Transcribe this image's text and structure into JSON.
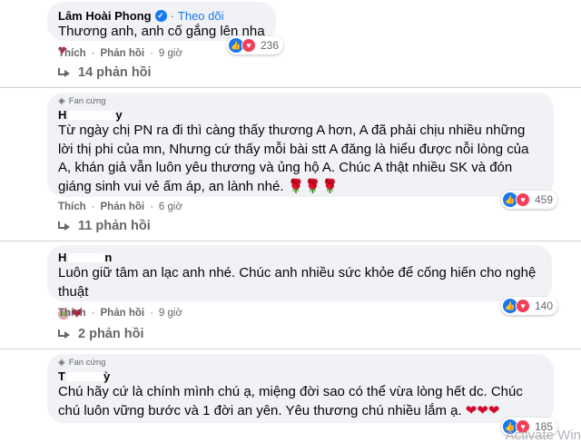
{
  "comments": [
    {
      "author": "Lâm Hoài Phong",
      "follow_label": "Theo dõi",
      "text": "Thương anh, anh cố gắng lên nha",
      "text_emoji": "♥",
      "reaction_count": "236",
      "like_label": "Thích",
      "reply_label": "Phản hồi",
      "time": "9 giờ",
      "replies_label": "14 phản hồi"
    },
    {
      "badge": "Fan cứng",
      "name_visible": "H",
      "name_tail": "y",
      "text": "Từ ngày chị PN ra đi thì càng thấy thương A hơn, A đã phải chịu nhiều những lời thị phi của mn, Nhưng cứ thấy mỗi bài stt A đăng là hiểu được nỗi lòng của A, khán giả vẫn luôn yêu thương và ủng hộ A. Chúc A thật nhiều SK và đón giáng sinh vui vẻ ấm áp, an lành nhé.",
      "text_emoji": "🌹🌹🌹",
      "reaction_count": "459",
      "like_label": "Thích",
      "reply_label": "Phản hồi",
      "time": "6 giờ",
      "replies_label": "11 phản hồi"
    },
    {
      "name_visible": "H",
      "name_tail": "n",
      "text": "Luôn giữ tâm an lạc anh nhé. Chúc anh nhiều sức khỏe để cống hiến cho nghệ thuật",
      "sticker": "❤",
      "reaction_count": "140",
      "like_label": "Thích",
      "reply_label": "Phản hồi",
      "time": "9 giờ",
      "replies_label": "2 phản hồi"
    },
    {
      "badge": "Fan cứng",
      "name_visible": "T",
      "name_tail": "ỳ",
      "text": "Chú hãy cứ là chính mình chú ạ, miệng đời sao có thể vừa lòng hết dc. Chúc chú luôn vững bước và 1 đời an yên. Yêu thương chú nhiều lắm ạ.",
      "text_emoji": "❤❤❤",
      "reaction_count": "185"
    }
  ],
  "watermark": "Activate Win",
  "colors": {
    "link": "#1877f2",
    "bubble": "#f0f2f5",
    "muted": "#65676b",
    "like": "#1877f2",
    "love": "#f33e58"
  }
}
